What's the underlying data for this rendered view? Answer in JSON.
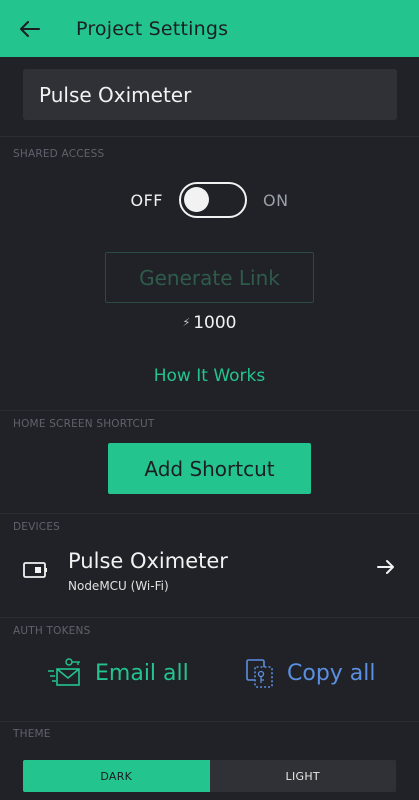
{
  "header": {
    "title": "Project Settings",
    "back_icon": "arrow-left-icon"
  },
  "project": {
    "name": "Pulse Oximeter"
  },
  "shared_access": {
    "section_label": "SHARED ACCESS",
    "off_label": "OFF",
    "on_label": "ON",
    "toggle_state": "off",
    "generate_link_label": "Generate Link",
    "energy_symbol": "⚡",
    "energy_cost": "1000",
    "how_it_works_label": "How It Works"
  },
  "home_screen": {
    "section_label": "HOME SCREEN SHORTCUT",
    "add_shortcut_label": "Add Shortcut"
  },
  "devices": {
    "section_label": "DEVICES",
    "items": [
      {
        "name": "Pulse Oximeter",
        "type": "NodeMCU (Wi-Fi)",
        "icon": "device-board-icon"
      }
    ]
  },
  "auth_tokens": {
    "section_label": "AUTH TOKENS",
    "email_all_label": "Email all",
    "copy_all_label": "Copy all"
  },
  "theme": {
    "section_label": "THEME",
    "dark_label": "DARK",
    "light_label": "LIGHT",
    "selected": "dark"
  },
  "colors": {
    "accent": "#23c48e",
    "background": "#212227",
    "field": "#2f3136",
    "link_blue": "#5b8fe0"
  }
}
